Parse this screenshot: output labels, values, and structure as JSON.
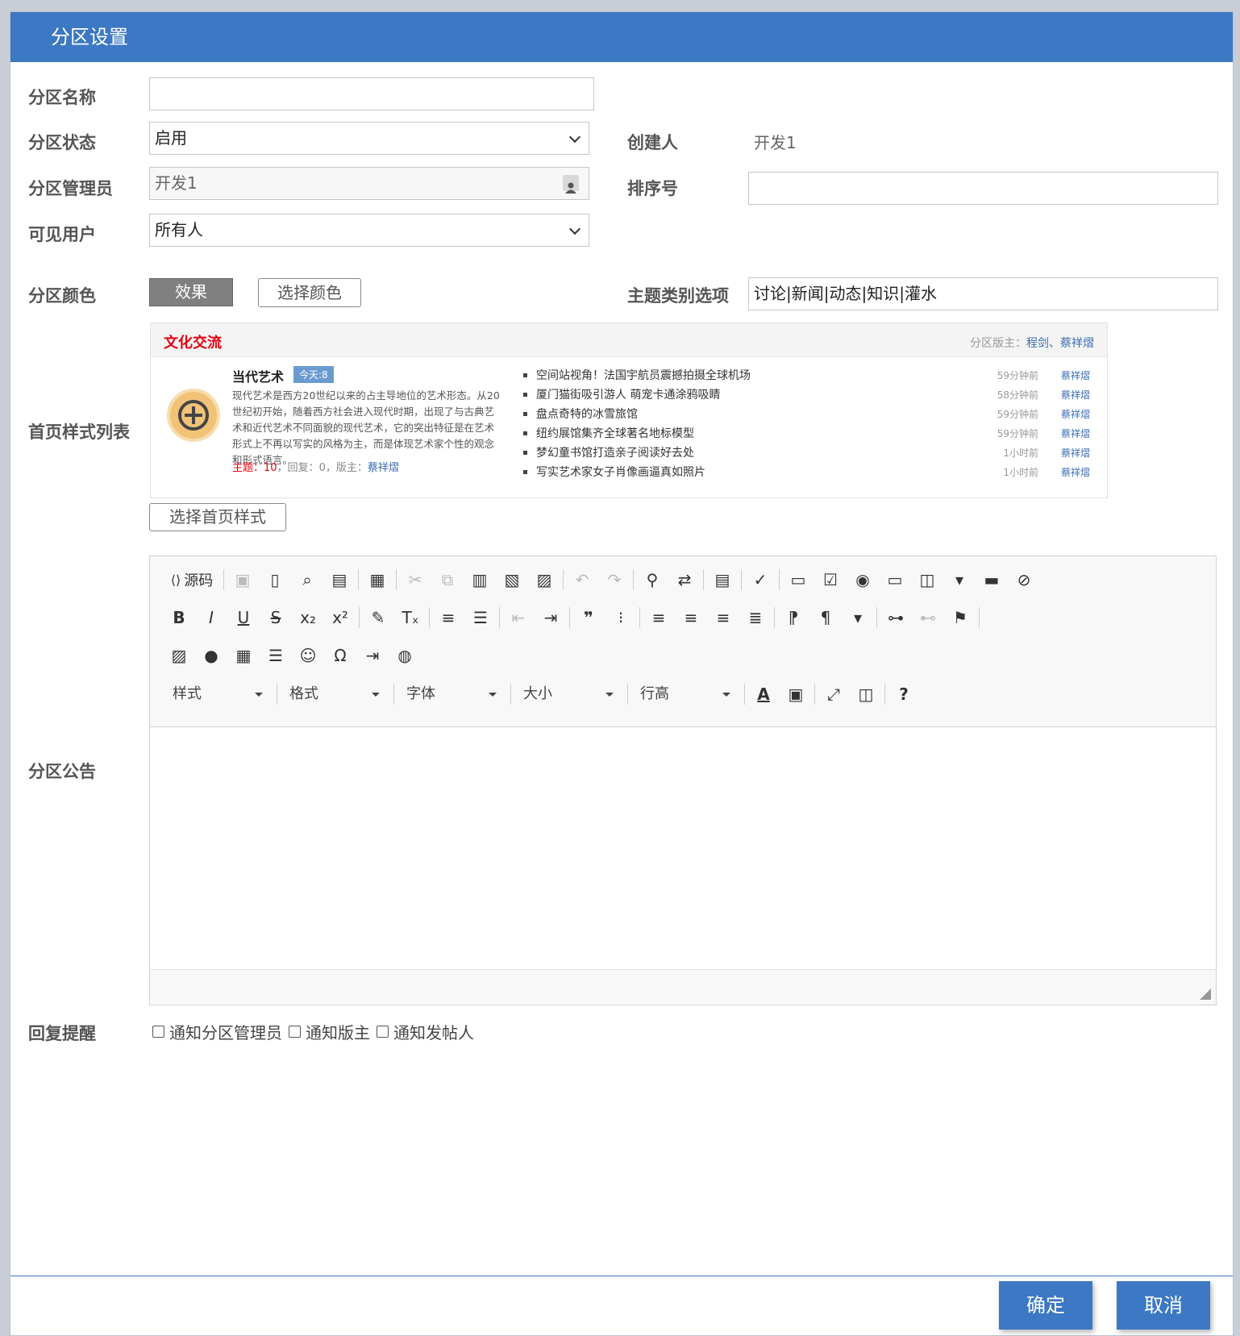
{
  "dialog": {
    "title": "分区设置"
  },
  "form": {
    "name_label": "分区名称",
    "name_value": "",
    "status_label": "分区状态",
    "status_value": "启用",
    "creator_label": "创建人",
    "creator_value": "开发1",
    "admin_label": "分区管理员",
    "admin_value": "开发1",
    "sort_label": "排序号",
    "sort_value": "",
    "visible_label": "可见用户",
    "visible_value": "所有人",
    "color_label": "分区颜色",
    "effect_button": "效果",
    "choose_color_button": "选择颜色",
    "topic_label": "主题类别选项",
    "topic_value": "讨论|新闻|动态|知识|灌水",
    "style_label": "首页样式列表",
    "choose_style_button": "选择首页样式",
    "notice_label": "分区公告",
    "reply_label": "回复提醒"
  },
  "preview": {
    "section_title": "文化交流",
    "moderators_prefix": "分区版主：",
    "moderators": "程剑、蔡祥熠",
    "forum_name": "当代艺术",
    "today_badge": "今天:8",
    "description": "现代艺术是西方20世纪以来的占主导地位的艺术形态。从20世纪初开始，随着西方社会进入现代时期，出现了与古典艺术和近代艺术不同面貌的现代艺术，它的突出特征是在艺术形式上不再以写实的风格为主，而是体现艺术家个性的观念和形式语言。",
    "stats_topic_label": "主题：",
    "stats_topic_value": "10",
    "stats_rest": "，回复：0，版主：",
    "stats_moderator": "蔡祥熠",
    "posts": [
      {
        "title": "空间站视角！法国宇航员震撼拍摄全球机场",
        "time": "59分钟前",
        "user": "蔡祥熠"
      },
      {
        "title": "厦门猫街吸引游人 萌宠卡通涂鸦吸睛",
        "time": "58分钟前",
        "user": "蔡祥熠"
      },
      {
        "title": "盘点奇特的冰雪旅馆",
        "time": "59分钟前",
        "user": "蔡祥熠"
      },
      {
        "title": "纽约展馆集齐全球著名地标模型",
        "time": "59分钟前",
        "user": "蔡祥熠"
      },
      {
        "title": "梦幻童书馆打造亲子阅读好去处",
        "time": "1小时前",
        "user": "蔡祥熠"
      },
      {
        "title": "写实艺术家女子肖像画逼真如照片",
        "time": "1小时前",
        "user": "蔡祥熠"
      }
    ]
  },
  "editor": {
    "source_label": "源码",
    "combo_style": "样式",
    "combo_format": "格式",
    "combo_font": "字体",
    "combo_size": "大小",
    "combo_lineheight": "行高",
    "help_icon": "?"
  },
  "checkboxes": {
    "notify_admin": "通知分区管理员",
    "notify_moderator": "通知版主",
    "notify_poster": "通知发帖人"
  },
  "footer": {
    "ok": "确定",
    "cancel": "取消"
  },
  "colors": {
    "primary": "#3c78c3",
    "accent_red": "#e60012",
    "link": "#3b6cb0"
  }
}
